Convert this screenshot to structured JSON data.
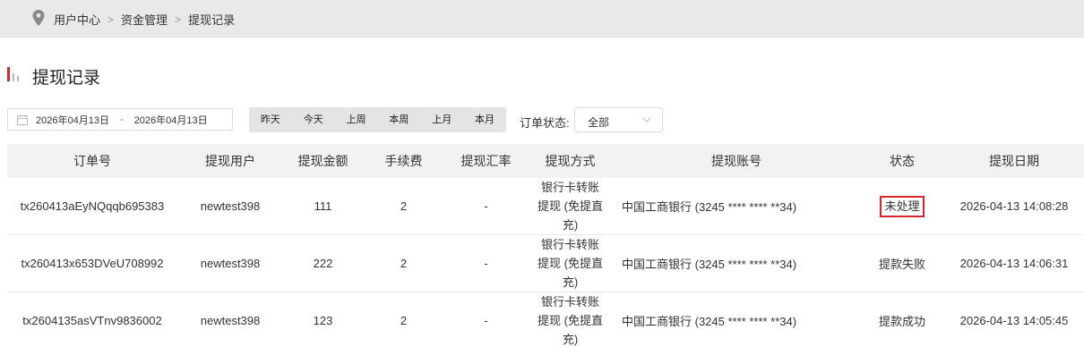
{
  "breadcrumb": {
    "items": [
      "用户中心",
      "资金管理",
      "提现记录"
    ],
    "separator": ">"
  },
  "page": {
    "title": "提现记录"
  },
  "filters": {
    "date_from": "2026年04月13日",
    "date_separator": "-",
    "date_to": "2026年04月13日",
    "quick_ranges": [
      "昨天",
      "今天",
      "上周",
      "本周",
      "上月",
      "本月"
    ],
    "status_label": "订单状态:",
    "status_value": "全部"
  },
  "table": {
    "columns": [
      "订单号",
      "提现用户",
      "提现金额",
      "手续费",
      "提现汇率",
      "提现方式",
      "提现账号",
      "状态",
      "提现日期"
    ],
    "rows": [
      {
        "order_no": "tx260413aEyNQqqb695383",
        "user": "newtest398",
        "amount": "111",
        "fee": "2",
        "rate": "-",
        "method_lines": [
          "银行卡转账",
          "提现 (免提直",
          "充)"
        ],
        "account": "中国工商银行 (3245 **** **** **34)",
        "status": "未处理",
        "date": "2026-04-13 14:08:28"
      },
      {
        "order_no": "tx260413x653DVeU708992",
        "user": "newtest398",
        "amount": "222",
        "fee": "2",
        "rate": "-",
        "method_lines": [
          "银行卡转账",
          "提现 (免提直",
          "充)"
        ],
        "account": "中国工商银行 (3245 **** **** **34)",
        "status": "提款失败",
        "date": "2026-04-13 14:06:31"
      },
      {
        "order_no": "tx2604135asVTnv9836002",
        "user": "newtest398",
        "amount": "123",
        "fee": "2",
        "rate": "-",
        "method_lines": [
          "银行卡转账",
          "提现 (免提直",
          "充)"
        ],
        "account": "中国工商银行 (3245 **** **** **34)",
        "status": "提款成功",
        "date": "2026-04-13 14:05:45"
      }
    ]
  },
  "colors": {
    "accent_red": "#d9242b",
    "header_bg": "#f2f2f2",
    "topbar_bg": "#e9e9e9"
  },
  "icons": {
    "breadcrumb": "location-pin-icon",
    "title": "bar-chart-icon",
    "date": "calendar-icon",
    "select": "chevron-down-icon"
  }
}
